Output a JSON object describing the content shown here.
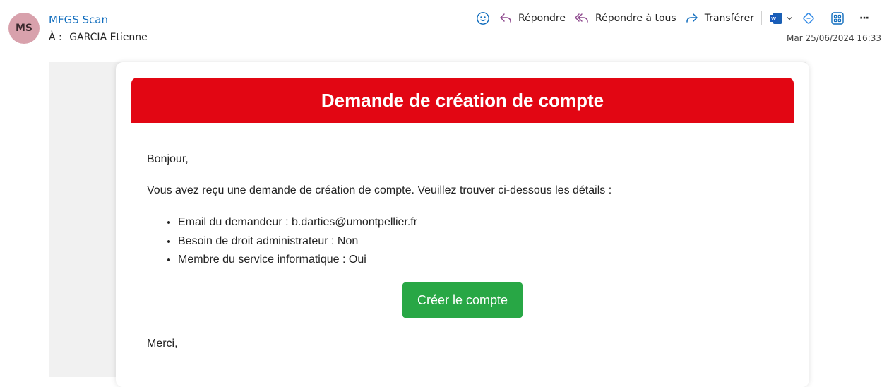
{
  "header": {
    "avatar_initials": "MS",
    "sender": "MFGS Scan",
    "to_prefix": "À :",
    "to_name": "GARCIA Etienne",
    "date": "Mar 25/06/2024 16:33"
  },
  "toolbar": {
    "emoji_icon": "smile-icon",
    "reply_label": "Répondre",
    "reply_all_label": "Répondre à tous",
    "forward_label": "Transférer",
    "word_icon": "word-icon",
    "more_label": "···",
    "accent_color": "#0f6cbd",
    "reply_color": "#8e4a8e"
  },
  "email": {
    "banner_title": "Demande de création de compte",
    "banner_color": "#e20613",
    "greeting": "Bonjour,",
    "intro": "Vous avez reçu une demande de création de compte. Veuillez trouver ci-dessous les détails :",
    "details": [
      "Email du demandeur : b.darties@umontpellier.fr",
      "Besoin de droit administrateur : Non",
      "Membre du service informatique : Oui"
    ],
    "cta_label": "Créer le compte",
    "cta_color": "#28a745",
    "thanks": "Merci,"
  }
}
